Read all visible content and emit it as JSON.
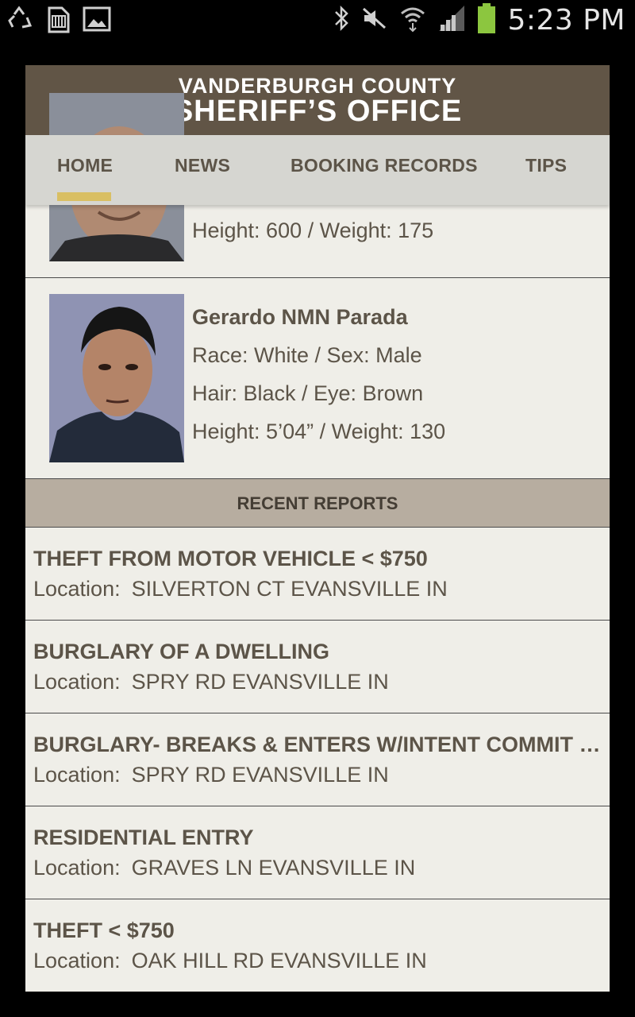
{
  "status_bar": {
    "time": "5:23 PM",
    "left_icons": [
      "recycle-icon",
      "sd-card-icon",
      "image-icon"
    ],
    "right_icons": [
      "bluetooth-icon",
      "mute-icon",
      "wifi-icon",
      "signal-icon",
      "battery-icon"
    ],
    "battery_color": "#8cc63f"
  },
  "brand": {
    "line1": "VANDERBURGH COUNTY",
    "line2": "SHERIFF’S OFFICE"
  },
  "nav": {
    "items": [
      {
        "label": "HOME",
        "active": true
      },
      {
        "label": "NEWS"
      },
      {
        "label": "BOOKING RECORDS"
      },
      {
        "label": "TIPS"
      }
    ],
    "active_color": "#d9bf63"
  },
  "bookings": [
    {
      "height_weight": "Height: 600 / Weight: 175"
    },
    {
      "name": "Gerardo NMN Parada",
      "race_sex": "Race: White / Sex: Male",
      "hair_eye": "Hair: Black / Eye: Brown",
      "height_weight": "Height: 5’04” / Weight: 130"
    }
  ],
  "recent_reports": {
    "header": "RECENT REPORTS",
    "location_label": "Location:",
    "items": [
      {
        "title": "THEFT FROM MOTOR VEHICLE < $750",
        "location": "SILVERTON CT EVANSVILLE IN"
      },
      {
        "title": "BURGLARY OF A DWELLING",
        "location": "SPRY RD EVANSVILLE IN"
      },
      {
        "title": "BURGLARY- BREAKS & ENTERS W/INTENT COMMIT FELONY",
        "location": "SPRY RD EVANSVILLE IN"
      },
      {
        "title": "RESIDENTIAL ENTRY",
        "location": "GRAVES LN EVANSVILLE IN"
      },
      {
        "title": "THEFT  < $750",
        "location": "OAK HILL RD EVANSVILLE IN"
      }
    ]
  },
  "colors": {
    "brand_bg": "#615546",
    "nav_bg": "#d6d6d1",
    "content_bg": "#efeee8",
    "text": "#5c5448",
    "section_header_bg": "#b7ada0"
  }
}
